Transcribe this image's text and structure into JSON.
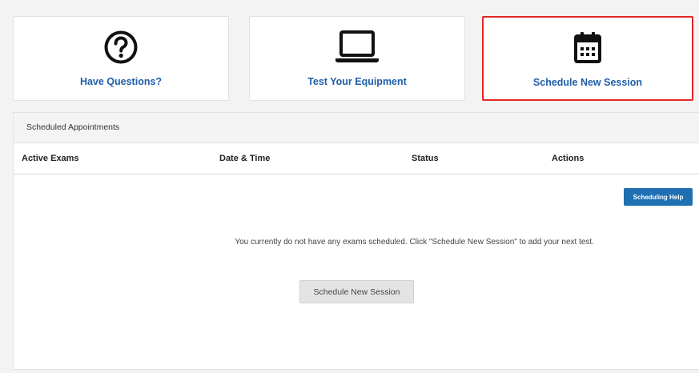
{
  "cards": [
    {
      "label": "Have Questions?",
      "icon": "question-circle-icon"
    },
    {
      "label": "Test Your Equipment",
      "icon": "laptop-icon"
    },
    {
      "label": "Schedule New Session",
      "icon": "calendar-icon",
      "highlight_color": "#e32424"
    }
  ],
  "panel": {
    "title": "Scheduled Appointments",
    "columns": [
      "Active Exams",
      "Date & Time",
      "Status",
      "Actions"
    ],
    "help_button": "Scheduling Help",
    "empty_message": "You currently do not have any exams scheduled. Click \"Schedule New Session\" to add your next test.",
    "schedule_button": "Schedule New Session"
  },
  "colors": {
    "link_blue": "#1f5ea8",
    "button_blue": "#1f6fb3",
    "highlight_red": "#e32424"
  }
}
